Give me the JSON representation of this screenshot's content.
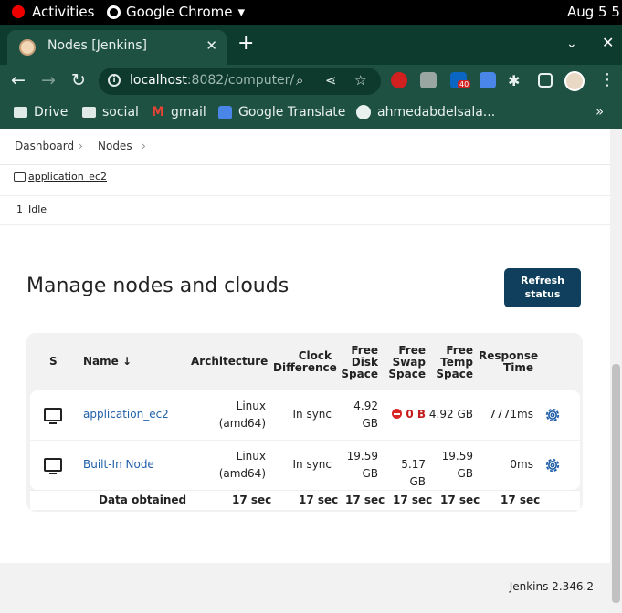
{
  "system": {
    "activities": "Activities",
    "app": "Google Chrome",
    "date": "Aug 5  5"
  },
  "browser": {
    "tab_title": "Nodes [Jenkins]",
    "url_host": "localhost",
    "url_path": ":8082/computer/",
    "extension_badge": "40",
    "bookmarks": [
      "Drive",
      "social",
      "gmail",
      "Google Translate",
      "ahmedabdelsala..."
    ]
  },
  "breadcrumb": [
    "Dashboard",
    "Nodes"
  ],
  "executors": {
    "node": "application_ec2",
    "num": "1",
    "state": "Idle"
  },
  "page": {
    "title": "Manage nodes and clouds",
    "refresh_label": "Refresh status"
  },
  "table": {
    "headers": {
      "s": "S",
      "name": "Name ↓",
      "arch": "Architecture",
      "clock": [
        "Clock",
        "Difference"
      ],
      "disk": [
        "Free",
        "Disk",
        "Space"
      ],
      "swap": [
        "Free",
        "Swap",
        "Space"
      ],
      "temp": [
        "Free",
        "Temp",
        "Space"
      ],
      "resp": [
        "Response",
        "Time"
      ]
    },
    "rows": [
      {
        "name": "application_ec2",
        "arch": [
          "Linux",
          "(amd64)"
        ],
        "clock": "In sync",
        "disk": [
          "4.92",
          "GB"
        ],
        "swap": "0 B",
        "temp": "4.92 GB",
        "resp": "7771ms"
      },
      {
        "name": "Built-In Node",
        "arch": [
          "Linux",
          "(amd64)"
        ],
        "clock": "In sync",
        "disk": [
          "19.59",
          "GB"
        ],
        "swap": "5.17 GB",
        "temp": [
          "19.59",
          "GB"
        ],
        "resp": "0ms"
      }
    ],
    "summary": {
      "label": "Data obtained",
      "arch": "17 sec",
      "clock": "17 sec",
      "disk": "17 sec",
      "swap": "17 sec",
      "temp": "17 sec",
      "resp": "17 sec"
    }
  },
  "footer": {
    "version": "Jenkins 2.346.2"
  },
  "colors": {
    "brand_dark": "#0f3f5c",
    "chrome_theme": "#1f5143",
    "link": "#1f5fa8",
    "error": "#d92424"
  }
}
